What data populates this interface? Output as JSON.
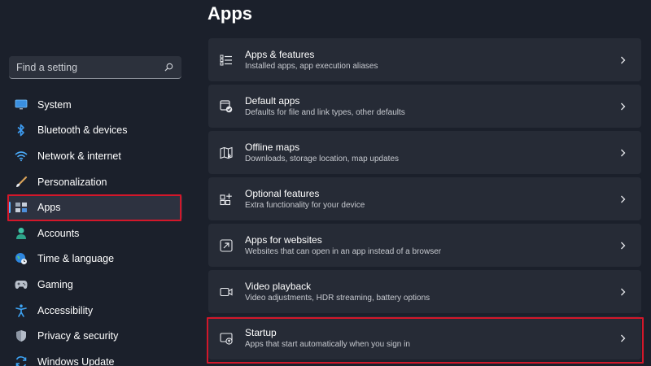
{
  "sidebar": {
    "search_placeholder": "Find a setting",
    "items": [
      {
        "label": "System",
        "icon": "monitor-icon"
      },
      {
        "label": "Bluetooth & devices",
        "icon": "bluetooth-icon"
      },
      {
        "label": "Network & internet",
        "icon": "wifi-icon"
      },
      {
        "label": "Personalization",
        "icon": "brush-icon"
      },
      {
        "label": "Apps",
        "icon": "apps-icon",
        "active": true
      },
      {
        "label": "Accounts",
        "icon": "person-icon"
      },
      {
        "label": "Time & language",
        "icon": "globe-clock-icon"
      },
      {
        "label": "Gaming",
        "icon": "gamepad-icon"
      },
      {
        "label": "Accessibility",
        "icon": "accessibility-icon"
      },
      {
        "label": "Privacy & security",
        "icon": "shield-icon"
      },
      {
        "label": "Windows Update",
        "icon": "update-icon"
      }
    ]
  },
  "main": {
    "title": "Apps",
    "cards": [
      {
        "title": "Apps & features",
        "desc": "Installed apps, app execution aliases",
        "icon": "list-icon"
      },
      {
        "title": "Default apps",
        "desc": "Defaults for file and link types, other defaults",
        "icon": "default-apps-icon"
      },
      {
        "title": "Offline maps",
        "desc": "Downloads, storage location, map updates",
        "icon": "map-icon"
      },
      {
        "title": "Optional features",
        "desc": "Extra functionality for your device",
        "icon": "add-grid-icon"
      },
      {
        "title": "Apps for websites",
        "desc": "Websites that can open in an app instead of a browser",
        "icon": "open-external-icon"
      },
      {
        "title": "Video playback",
        "desc": "Video adjustments, HDR streaming, battery options",
        "icon": "video-icon"
      },
      {
        "title": "Startup",
        "desc": "Apps that start automatically when you sign in",
        "icon": "startup-icon"
      }
    ]
  },
  "colors": {
    "background": "#1b202b",
    "card": "#262b36",
    "accent": "#5db4ff",
    "highlight": "#d3172a"
  }
}
